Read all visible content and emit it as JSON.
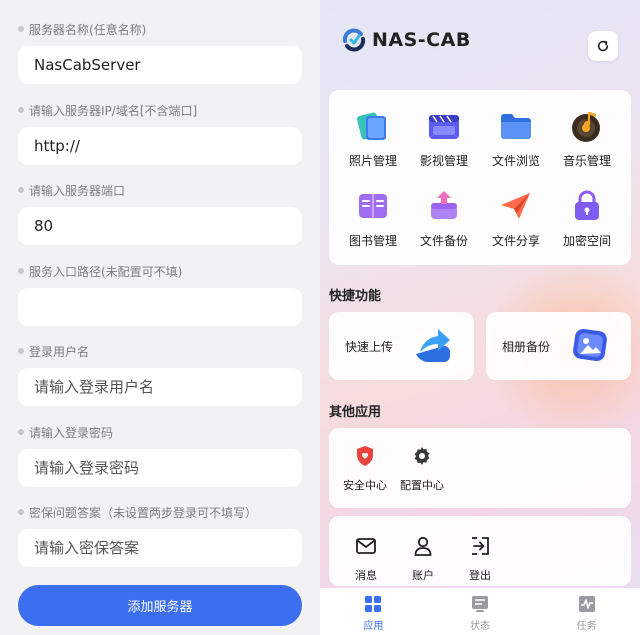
{
  "form": {
    "fields": [
      {
        "label": "服务器名称(任意名称)",
        "value": "NasCabServer",
        "placeholder": ""
      },
      {
        "label": "请输入服务器IP/域名[不含端口]",
        "value": "http://",
        "placeholder": ""
      },
      {
        "label": "请输入服务器端口",
        "value": "80",
        "placeholder": ""
      },
      {
        "label": "服务入口路径(未配置可不填)",
        "value": "",
        "placeholder": ""
      },
      {
        "label": "登录用户名",
        "value": "",
        "placeholder": "请输入登录用户名"
      },
      {
        "label": "请输入登录密码",
        "value": "",
        "placeholder": "请输入登录密码"
      },
      {
        "label": "密保问题答案（未设置两步登录可不填写）",
        "value": "",
        "placeholder": "请输入密保答案"
      }
    ],
    "submit_label": "添加服务器"
  },
  "app": {
    "logo_text": "NAS-CAB",
    "main_grid": [
      {
        "label": "照片管理",
        "icon": "photos-icon"
      },
      {
        "label": "影视管理",
        "icon": "video-icon"
      },
      {
        "label": "文件浏览",
        "icon": "folder-icon"
      },
      {
        "label": "音乐管理",
        "icon": "music-icon"
      },
      {
        "label": "图书管理",
        "icon": "book-icon"
      },
      {
        "label": "文件备份",
        "icon": "backup-icon"
      },
      {
        "label": "文件分享",
        "icon": "share-icon"
      },
      {
        "label": "加密空间",
        "icon": "lock-icon"
      }
    ],
    "quick_title": "快捷功能",
    "quick": [
      {
        "label": "快速上传",
        "icon": "upload-icon"
      },
      {
        "label": "相册备份",
        "icon": "album-backup-icon"
      }
    ],
    "other_title": "其他应用",
    "other": [
      {
        "label": "安全中心",
        "icon": "shield-icon"
      },
      {
        "label": "配置中心",
        "icon": "gear-icon"
      }
    ],
    "account": [
      {
        "label": "消息",
        "icon": "mail-icon"
      },
      {
        "label": "账户",
        "icon": "user-icon"
      },
      {
        "label": "登出",
        "icon": "logout-icon"
      }
    ],
    "tabs": [
      {
        "label": "应用",
        "icon": "apps-icon",
        "active": true
      },
      {
        "label": "状态",
        "icon": "status-icon",
        "active": false
      },
      {
        "label": "任务",
        "icon": "task-icon",
        "active": false
      }
    ]
  },
  "colors": {
    "accent": "#3c6ef0",
    "inactive": "#9a9aa2"
  }
}
